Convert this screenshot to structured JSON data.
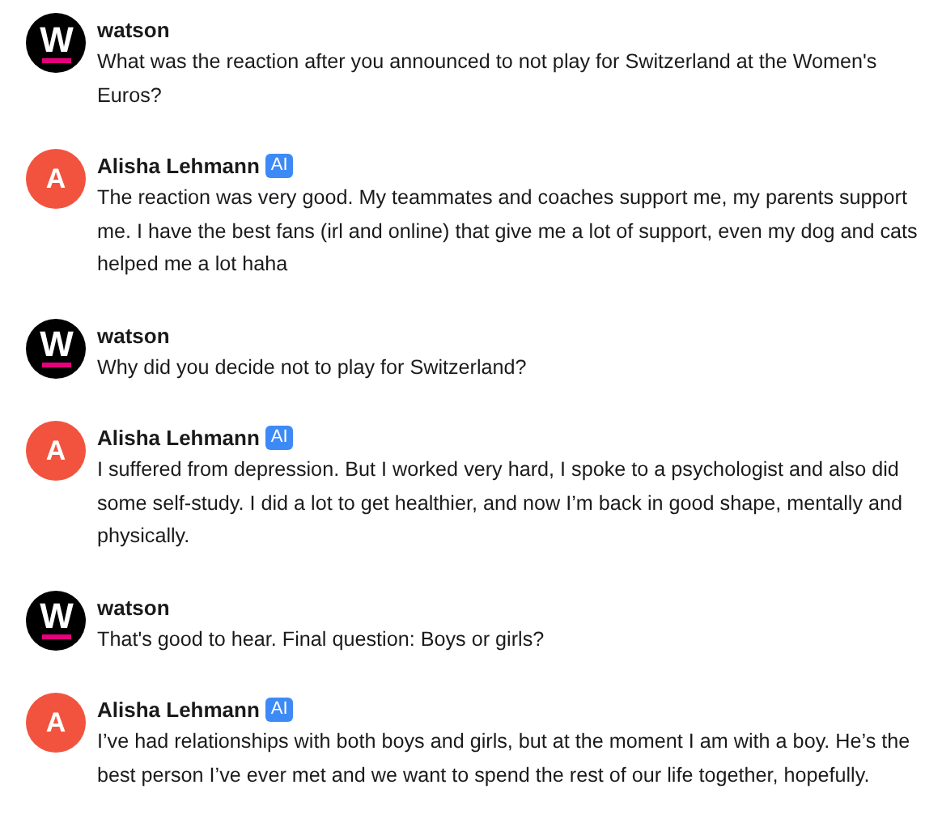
{
  "messages": [
    {
      "kind": "brand",
      "avatar": "W",
      "author": "watson",
      "text": "What was the reaction after you announced to not play for Switzerland at the Women's Euros?"
    },
    {
      "kind": "person",
      "avatar": "A",
      "author": "Alisha Lehmann",
      "badge": "AI",
      "text": "The reaction was very good. My teammates and coaches support me, my parents support me. I have the best fans (irl and online) that give me a lot of support, even my dog and cats helped me a lot haha"
    },
    {
      "kind": "brand",
      "avatar": "W",
      "author": "watson",
      "text": "Why did you decide not to play for Switzerland?"
    },
    {
      "kind": "person",
      "avatar": "A",
      "author": "Alisha Lehmann",
      "badge": "AI",
      "text": "I suffered from depression. But I worked very hard, I spoke to a psychologist and also did some self-study. I did a lot to get healthier, and now I’m back in good shape, mentally and physically."
    },
    {
      "kind": "brand",
      "avatar": "W",
      "author": "watson",
      "text": "That's good to hear. Final question: Boys or girls?"
    },
    {
      "kind": "person",
      "avatar": "A",
      "author": "Alisha Lehmann",
      "badge": "AI",
      "text": "I’ve had relationships with both boys and girls, but at the moment I am with a boy. He’s the best person I’ve ever met and we want to spend the rest of our life together, hopefully."
    }
  ]
}
